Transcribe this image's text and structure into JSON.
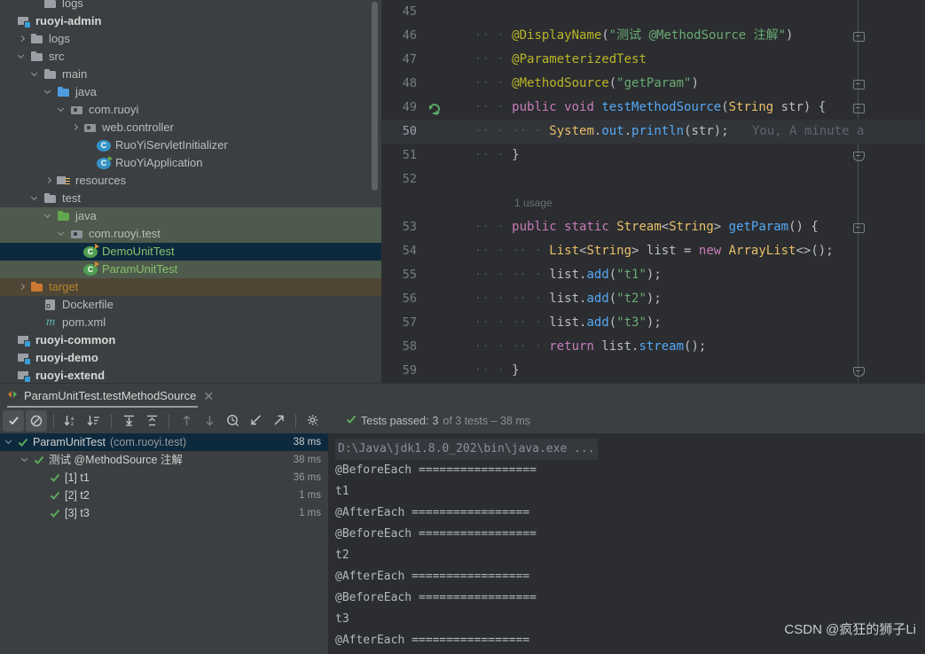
{
  "project_tree": [
    {
      "label": "logs",
      "depth": 2,
      "icon": "folder-icon",
      "arrow": "none",
      "style": "partial"
    },
    {
      "label": "ruoyi-admin",
      "depth": 0,
      "icon": "module-icon",
      "arrow": "none",
      "style": "bold"
    },
    {
      "label": "logs",
      "depth": 1,
      "icon": "folder-icon",
      "arrow": "right"
    },
    {
      "label": "src",
      "depth": 1,
      "icon": "folder-icon",
      "arrow": "down"
    },
    {
      "label": "main",
      "depth": 2,
      "icon": "folder-icon",
      "arrow": "down"
    },
    {
      "label": "java",
      "depth": 3,
      "icon": "folder-blue-icon",
      "arrow": "down"
    },
    {
      "label": "com.ruoyi",
      "depth": 4,
      "icon": "package-icon",
      "arrow": "down"
    },
    {
      "label": "web.controller",
      "depth": 5,
      "icon": "package-icon",
      "arrow": "right"
    },
    {
      "label": "RuoYiServletInitializer",
      "depth": 6,
      "icon": "class-icon",
      "arrow": "none"
    },
    {
      "label": "RuoYiApplication",
      "depth": 6,
      "icon": "class-runnable-icon",
      "arrow": "none"
    },
    {
      "label": "resources",
      "depth": 3,
      "icon": "resources-folder-icon",
      "arrow": "right"
    },
    {
      "label": "test",
      "depth": 2,
      "icon": "folder-icon",
      "arrow": "down"
    },
    {
      "label": "java",
      "depth": 3,
      "icon": "folder-green-icon",
      "arrow": "down",
      "style": "test-source"
    },
    {
      "label": "com.ruoyi.test",
      "depth": 4,
      "icon": "package-icon",
      "arrow": "down",
      "style": "test-source"
    },
    {
      "label": "DemoUnitTest",
      "depth": 5,
      "icon": "test-class-icon",
      "arrow": "none",
      "style": "selected"
    },
    {
      "label": "ParamUnitTest",
      "depth": 5,
      "icon": "test-class-icon",
      "arrow": "none",
      "style": "test-source"
    },
    {
      "label": "target",
      "depth": 1,
      "icon": "folder-orange-icon",
      "arrow": "right",
      "style": "excluded"
    },
    {
      "label": "Dockerfile",
      "depth": 2,
      "icon": "docker-icon",
      "arrow": "none"
    },
    {
      "label": "pom.xml",
      "depth": 2,
      "icon": "maven-icon",
      "arrow": "none"
    },
    {
      "label": "ruoyi-common",
      "depth": 0,
      "icon": "module-icon",
      "arrow": "none",
      "style": "bold"
    },
    {
      "label": "ruoyi-demo",
      "depth": 0,
      "icon": "module-icon",
      "arrow": "none",
      "style": "bold"
    },
    {
      "label": "ruoyi-extend",
      "depth": 0,
      "icon": "module-icon",
      "arrow": "none",
      "style": "bold"
    }
  ],
  "editor": {
    "lines": [
      {
        "num": "45",
        "fold": false,
        "code": ""
      },
      {
        "num": "46",
        "fold": "open",
        "code": "@DisplayName(\"测试 @MethodSource 注解\")"
      },
      {
        "num": "47",
        "fold": false,
        "code": "@ParameterizedTest"
      },
      {
        "num": "48",
        "fold": "open",
        "code": "@MethodSource(\"getParam\")"
      },
      {
        "num": "49",
        "fold": "open",
        "code": "public void testMethodSource(String str) {",
        "gutter": "run-success-icon"
      },
      {
        "num": "50",
        "fold": false,
        "code": "System.out.println(str);",
        "inline_hint": "You, A minute a",
        "caret": true
      },
      {
        "num": "51",
        "fold": "end",
        "code": "}"
      },
      {
        "num": "52",
        "fold": false,
        "code": ""
      },
      {
        "num": "",
        "fold": false,
        "code": "",
        "usage": "1 usage"
      },
      {
        "num": "53",
        "fold": "open",
        "code": "public static Stream<String> getParam() {"
      },
      {
        "num": "54",
        "fold": false,
        "code": "List<String> list = new ArrayList<>();"
      },
      {
        "num": "55",
        "fold": false,
        "code": "list.add(\"t1\");"
      },
      {
        "num": "56",
        "fold": false,
        "code": "list.add(\"t2\");"
      },
      {
        "num": "57",
        "fold": false,
        "code": "list.add(\"t3\");"
      },
      {
        "num": "58",
        "fold": false,
        "code": "return list.stream();"
      },
      {
        "num": "59",
        "fold": "end",
        "code": "}"
      }
    ]
  },
  "run_panel": {
    "tab_label": "ParamUnitTest.testMethodSource",
    "tab_close": "✕",
    "toolbar": [
      {
        "name": "show-passed-toggle",
        "glyph": "✔",
        "active": true
      },
      {
        "name": "show-ignored-toggle",
        "glyph": "⊘",
        "active": true
      },
      {
        "name": "sort-alphabetically-button",
        "glyph": "↓ᵃz"
      },
      {
        "name": "sort-by-duration-button",
        "glyph": "↓≡"
      },
      {
        "name": "expand-all-button",
        "glyph": "⤒"
      },
      {
        "name": "collapse-all-button",
        "glyph": "⤓"
      },
      {
        "name": "previous-failed-test-button",
        "glyph": "↑"
      },
      {
        "name": "next-failed-test-button",
        "glyph": "↓"
      },
      {
        "name": "test-history-button",
        "glyph": "🕓"
      },
      {
        "name": "import-tests-button",
        "glyph": "↙"
      },
      {
        "name": "export-tests-button",
        "glyph": "↗"
      },
      {
        "name": "settings-button",
        "glyph": "⚙"
      }
    ],
    "status": {
      "prefix": "Tests passed:",
      "count": "3",
      "suffix": "of 3 tests – 38 ms"
    },
    "tests": [
      {
        "label": "ParamUnitTest",
        "package": "(com.ruoyi.test)",
        "duration": "38 ms",
        "depth": 0,
        "arrow": "down",
        "selected": true
      },
      {
        "label": "测试 @MethodSource 注解",
        "package": "",
        "duration": "38 ms",
        "depth": 1,
        "arrow": "down"
      },
      {
        "label": "[1] t1",
        "package": "",
        "duration": "36 ms",
        "depth": 2,
        "arrow": "none"
      },
      {
        "label": "[2] t2",
        "package": "",
        "duration": "1 ms",
        "depth": 2,
        "arrow": "none"
      },
      {
        "label": "[3] t3",
        "package": "",
        "duration": "1 ms",
        "depth": 2,
        "arrow": "none"
      }
    ],
    "console": [
      {
        "text": "D:\\Java\\jdk1.8.0_202\\bin\\java.exe ...",
        "kind": "cmd"
      },
      {
        "text": "@BeforeEach =================",
        "kind": "out"
      },
      {
        "text": "t1",
        "kind": "out"
      },
      {
        "text": "@AfterEach =================",
        "kind": "out"
      },
      {
        "text": "@BeforeEach =================",
        "kind": "out"
      },
      {
        "text": "t2",
        "kind": "out"
      },
      {
        "text": "@AfterEach =================",
        "kind": "out"
      },
      {
        "text": "@BeforeEach =================",
        "kind": "out"
      },
      {
        "text": "t3",
        "kind": "out"
      },
      {
        "text": "@AfterEach =================",
        "kind": "out"
      }
    ]
  },
  "watermark": "CSDN @疯狂的狮子Li",
  "colors": {
    "selection": "#0d293e",
    "test_source": "#4e5a4c",
    "excluded": "#4f4636",
    "panel_bg": "#3c3f41",
    "editor_bg": "#2b2d30",
    "pass_green": "#5ca85c"
  }
}
